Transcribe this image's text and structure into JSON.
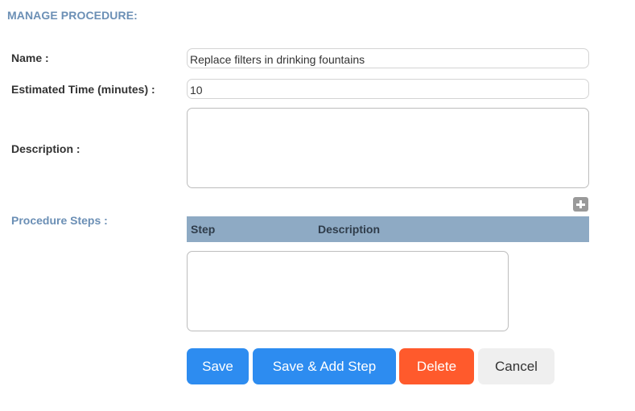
{
  "page": {
    "title": "MANAGE PROCEDURE:"
  },
  "form": {
    "name_label": "Name :",
    "name_value": "Replace filters in drinking fountains",
    "time_label": "Estimated Time (minutes) :",
    "time_value": "10",
    "description_label": "Description :",
    "description_value": ""
  },
  "steps": {
    "label": "Procedure Steps :",
    "add_icon": "plus-icon",
    "columns": [
      "Step",
      "Description"
    ],
    "rows": []
  },
  "buttons": {
    "save": "Save",
    "save_add": "Save & Add Step",
    "delete": "Delete",
    "cancel": "Cancel"
  },
  "colors": {
    "title_blue": "#6b8fb5",
    "header_bg": "#8eaac4",
    "primary": "#2d8cf0",
    "danger": "#ff5a2c",
    "neutral": "#efefef"
  }
}
